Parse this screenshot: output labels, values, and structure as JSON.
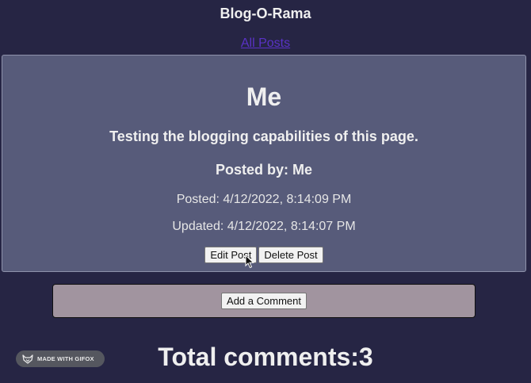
{
  "header": {
    "title": "Blog-O-Rama",
    "nav_link": "All Posts"
  },
  "post": {
    "title": "Me",
    "body": "Testing the blogging capabilities of this page.",
    "author_line": "Posted by: Me",
    "posted": "Posted: 4/12/2022, 8:14:09 PM",
    "updated": "Updated: 4/12/2022, 8:14:07 PM",
    "edit_label": "Edit Post",
    "delete_label": "Delete Post"
  },
  "comments": {
    "add_label": "Add a Comment",
    "total_label": "Total comments:3"
  },
  "badge": {
    "text": "MADE WITH GIFOX",
    "icon": "fox-icon"
  },
  "colors": {
    "background": "#262544",
    "card": "#575b7a",
    "comment_box": "#a1949f",
    "link": "#5a32c7"
  }
}
